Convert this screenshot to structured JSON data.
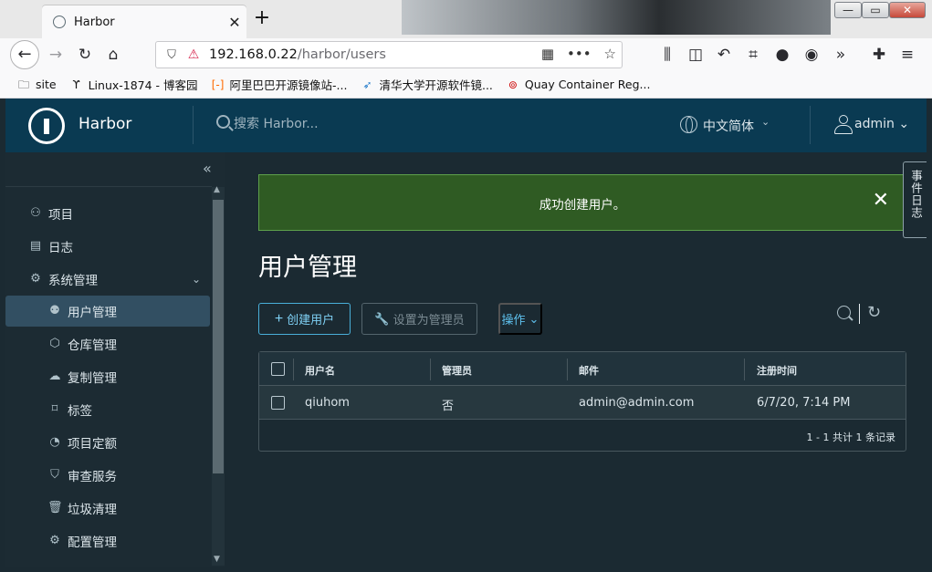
{
  "browser": {
    "tab_title": "Harbor",
    "tab_close": "✕",
    "new_tab": "+",
    "url_host": "192.168.0.22",
    "url_path": "/harbor/users",
    "window_controls": [
      "—",
      "▭",
      "✕"
    ],
    "bookmarks": [
      {
        "label": "site",
        "icon": "folder-icon"
      },
      {
        "label": "Linux-1874 - 博客园",
        "icon": "cnblogs-icon"
      },
      {
        "label": "阿里巴巴开源镜像站-...",
        "icon": "aliyun-icon"
      },
      {
        "label": "清华大学开源软件镜...",
        "icon": "tsinghua-icon"
      },
      {
        "label": "Quay Container Reg...",
        "icon": "quay-icon"
      }
    ]
  },
  "header": {
    "app_name": "Harbor",
    "search_placeholder": "搜索 Harbor...",
    "language": "中文简体",
    "user": "admin"
  },
  "sidebar": {
    "items": [
      {
        "label": "项目",
        "icon": "projects-icon",
        "level": "top"
      },
      {
        "label": "日志",
        "icon": "logs-icon",
        "level": "top"
      },
      {
        "label": "系统管理",
        "icon": "system-admin-icon",
        "level": "top",
        "expanded": true
      },
      {
        "label": "用户管理",
        "icon": "users-icon",
        "level": "sub",
        "active": true
      },
      {
        "label": "仓库管理",
        "icon": "registry-icon",
        "level": "sub"
      },
      {
        "label": "复制管理",
        "icon": "replication-icon",
        "level": "sub"
      },
      {
        "label": "标签",
        "icon": "tag-icon",
        "level": "sub"
      },
      {
        "label": "项目定额",
        "icon": "quota-icon",
        "level": "sub"
      },
      {
        "label": "审查服务",
        "icon": "scanner-icon",
        "level": "sub"
      },
      {
        "label": "垃圾清理",
        "icon": "trash-icon",
        "level": "sub"
      },
      {
        "label": "配置管理",
        "icon": "gear-icon",
        "level": "sub"
      }
    ]
  },
  "alert": {
    "message": "成功创建用户。"
  },
  "event_log_tab": "事件日志",
  "page": {
    "title": "用户管理",
    "create_user": "创建用户",
    "set_admin": "设置为管理员",
    "actions": "操作"
  },
  "table": {
    "columns": [
      "用户名",
      "管理员",
      "邮件",
      "注册时间"
    ],
    "rows": [
      {
        "username": "qiuhom",
        "admin": "否",
        "email": "admin@admin.com",
        "registered": "6/7/20, 7:14 PM"
      }
    ],
    "footer": "1 - 1 共计 1 条记录"
  }
}
